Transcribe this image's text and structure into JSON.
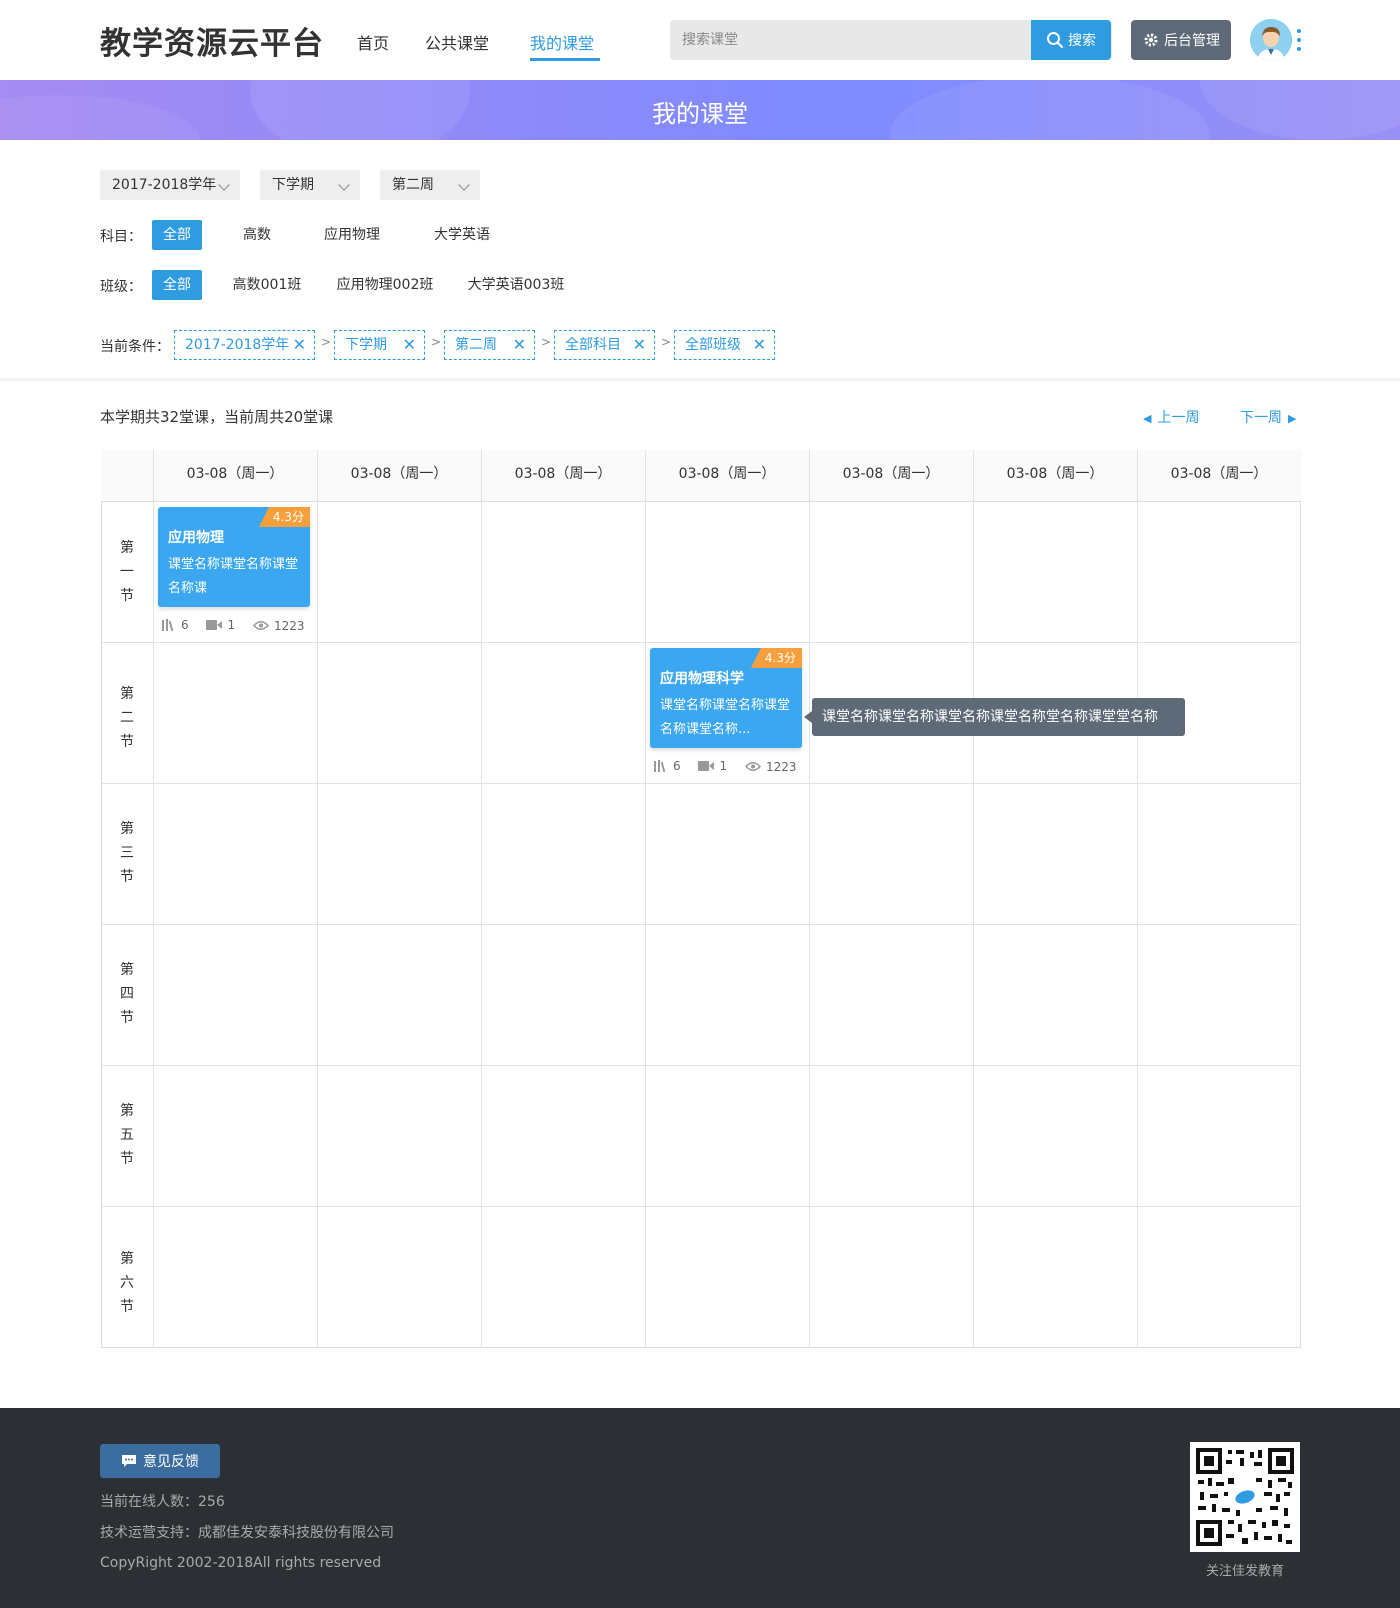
{
  "header": {
    "logo": "教学资源云平台",
    "nav": [
      {
        "label": "首页",
        "active": false
      },
      {
        "label": "公共课堂",
        "active": false
      },
      {
        "label": "我的课堂",
        "active": true
      }
    ],
    "search_placeholder": "搜索课堂",
    "search_button": "搜索",
    "admin_button": "后台管理"
  },
  "banner": {
    "title": "我的课堂"
  },
  "filters": {
    "year": "2017-2018学年",
    "term": "下学期",
    "week": "第二周",
    "subject_label": "科目：",
    "subjects": [
      "全部",
      "高数",
      "应用物理",
      "大学英语"
    ],
    "class_label": "班级：",
    "classes": [
      "全部",
      "高数001班",
      "应用物理002班",
      "大学英语003班"
    ],
    "conditions_label": "当前条件：",
    "conditions": [
      "2017-2018学年",
      "下学期",
      "第二周",
      "全部科目",
      "全部班级"
    ],
    "separator": ">"
  },
  "summary": {
    "text": "本学期共32堂课，当前周共20堂课",
    "prev_week": "上一周",
    "next_week": "下一周"
  },
  "timetable": {
    "days": [
      "03-08（周一）",
      "03-08（周一）",
      "03-08（周一）",
      "03-08（周一）",
      "03-08（周一）",
      "03-08（周一）",
      "03-08（周一）"
    ],
    "periods": [
      [
        "第",
        "一",
        "节"
      ],
      [
        "第",
        "二",
        "节"
      ],
      [
        "第",
        "三",
        "节"
      ],
      [
        "第",
        "四",
        "节"
      ],
      [
        "第",
        "五",
        "节"
      ],
      [
        "第",
        "六",
        "节"
      ]
    ],
    "cards": [
      {
        "day": 0,
        "period": 0,
        "badge": "4.3分",
        "title": "应用物理",
        "desc": "课堂名称课堂名称课堂名称课",
        "resources": "6",
        "videos": "1",
        "views": "1223"
      },
      {
        "day": 3,
        "period": 1,
        "badge": "4.3分",
        "title": "应用物理科学",
        "desc": "课堂名称课堂名称课堂名称课堂名称...",
        "resources": "6",
        "videos": "1",
        "views": "1223"
      }
    ],
    "tooltip": "课堂名称课堂名称课堂名称课堂名称堂名称课堂堂名称"
  },
  "footer": {
    "feedback_button": "意见反馈",
    "online_users": "当前在线人数：256",
    "support": "技术运营支持：成都佳发安泰科技股份有限公司",
    "copyright": "CopyRight 2002-2018All rights reserved",
    "qr_caption": "关注佳发教育"
  },
  "colors": {
    "accent": "#2f9be0",
    "card": "#3ba7f0",
    "badge": "#f5a03c",
    "footer_bg": "#2c2f34",
    "admin_btn": "#5f6a78"
  }
}
